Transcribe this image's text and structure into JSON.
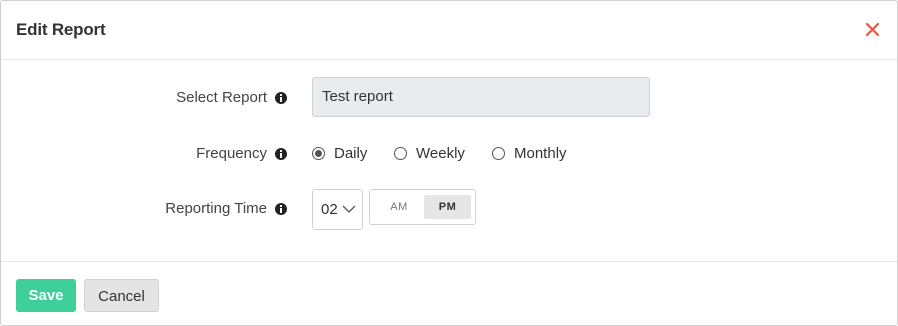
{
  "header": {
    "title": "Edit Report",
    "close_icon": "close-icon",
    "close_color": "#e05a46"
  },
  "form": {
    "select_report": {
      "label": "Select Report",
      "value": "Test report",
      "info_icon": "info-icon"
    },
    "frequency": {
      "label": "Frequency",
      "info_icon": "info-icon",
      "options": [
        {
          "label": "Daily",
          "checked": true
        },
        {
          "label": "Weekly",
          "checked": false
        },
        {
          "label": "Monthly",
          "checked": false
        }
      ]
    },
    "reporting_time": {
      "label": "Reporting Time",
      "info_icon": "info-icon",
      "hour": "02",
      "am_label": "AM",
      "pm_label": "PM",
      "selected": "PM"
    }
  },
  "footer": {
    "save_label": "Save",
    "cancel_label": "Cancel",
    "save_color": "#3fcf9b"
  }
}
